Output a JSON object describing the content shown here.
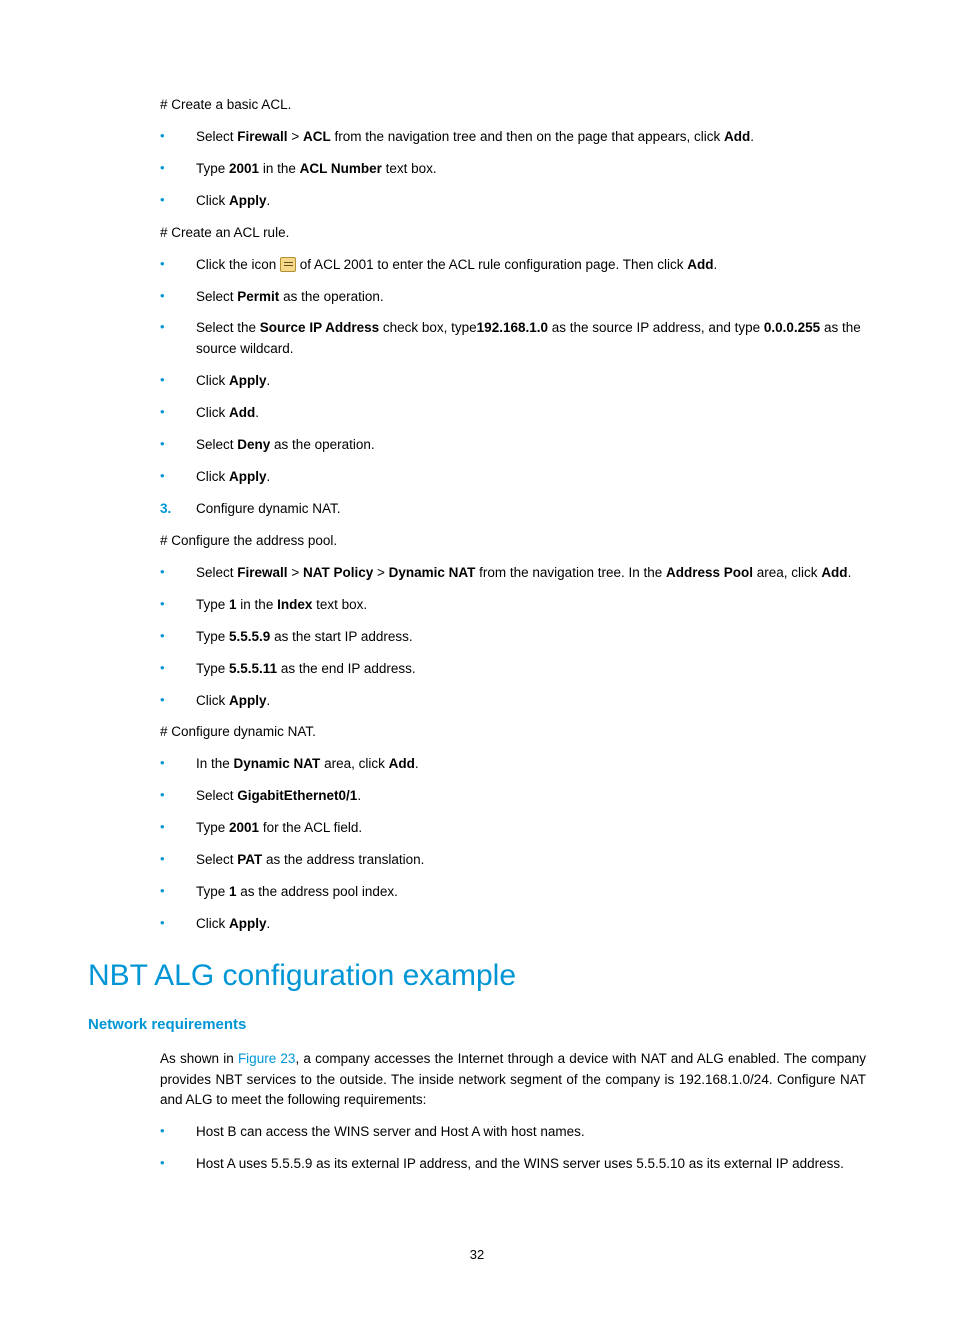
{
  "s1_para": "# Create a basic ACL.",
  "s1_b1_a": "Select ",
  "s1_b1_b": "Firewall",
  "s1_b1_c": " > ",
  "s1_b1_d": "ACL",
  "s1_b1_e": " from the navigation tree and then on the page that appears, click ",
  "s1_b1_f": "Add",
  "s1_b1_g": ".",
  "s1_b2_a": "Type ",
  "s1_b2_b": "2001",
  "s1_b2_c": " in the ",
  "s1_b2_d": "ACL Number",
  "s1_b2_e": " text box.",
  "s1_b3_a": "Click ",
  "s1_b3_b": "Apply",
  "s1_b3_c": ".",
  "s2_para": "# Create an ACL rule.",
  "s2_b1_a": "Click the icon ",
  "s2_b1_b": " of ACL 2001 to enter the ACL rule configuration page. Then click ",
  "s2_b1_c": "Add",
  "s2_b1_d": ".",
  "s2_b2_a": "Select ",
  "s2_b2_b": "Permit",
  "s2_b2_c": " as the operation.",
  "s2_b3_a": "Select the ",
  "s2_b3_b": "Source IP Address",
  "s2_b3_c": " check box, type",
  "s2_b3_d": "192.168.1.0",
  "s2_b3_e": " as the source IP address, and type ",
  "s2_b3_f": "0.0.0.255",
  "s2_b3_g": " as the source wildcard.",
  "s2_b4_a": "Click ",
  "s2_b4_b": "Apply",
  "s2_b4_c": ".",
  "s2_b5_a": "Click ",
  "s2_b5_b": "Add",
  "s2_b5_c": ".",
  "s2_b6_a": "Select ",
  "s2_b6_b": "Deny",
  "s2_b6_c": " as the operation.",
  "s2_b7_a": "Click ",
  "s2_b7_b": "Apply",
  "s2_b7_c": ".",
  "step3_num": "3.",
  "step3_text": "Configure dynamic NAT.",
  "s3_para": "# Configure the address pool.",
  "s3_b1_a": "Select ",
  "s3_b1_b": "Firewall",
  "s3_b1_c": " > ",
  "s3_b1_d": "NAT Policy",
  "s3_b1_e": " > ",
  "s3_b1_f": "Dynamic NAT",
  "s3_b1_g": " from the navigation tree. In the ",
  "s3_b1_h": "Address Pool",
  "s3_b1_i": " area, click ",
  "s3_b1_j": "Add",
  "s3_b1_k": ".",
  "s3_b2_a": "Type ",
  "s3_b2_b": "1",
  "s3_b2_c": " in the ",
  "s3_b2_d": "Index",
  "s3_b2_e": " text box.",
  "s3_b3_a": "Type ",
  "s3_b3_b": "5.5.5.9",
  "s3_b3_c": " as the start IP address.",
  "s3_b4_a": "Type ",
  "s3_b4_b": "5.5.5.11",
  "s3_b4_c": " as the end IP address.",
  "s3_b5_a": "Click ",
  "s3_b5_b": "Apply",
  "s3_b5_c": ".",
  "s4_para": "# Configure dynamic NAT.",
  "s4_b1_a": "In the ",
  "s4_b1_b": "Dynamic NAT",
  "s4_b1_c": " area, click ",
  "s4_b1_d": "Add",
  "s4_b1_e": ".",
  "s4_b2_a": "Select ",
  "s4_b2_b": "GigabitEthernet0/1",
  "s4_b2_c": ".",
  "s4_b3_a": "Type ",
  "s4_b3_b": "2001",
  "s4_b3_c": " for the ACL field.",
  "s4_b4_a": "Select ",
  "s4_b4_b": "PAT",
  "s4_b4_c": " as the address translation.",
  "s4_b5_a": "Type ",
  "s4_b5_b": "1",
  "s4_b5_c": " as the address pool index.",
  "s4_b6_a": "Click ",
  "s4_b6_b": "Apply",
  "s4_b6_c": ".",
  "h1": "NBT ALG configuration example",
  "h2": "Network requirements",
  "intro_a": "As shown in ",
  "intro_fig": "Figure 23",
  "intro_b": ", a company accesses the Internet through a device with NAT and ALG enabled. The company provides NBT services to the outside. The inside network segment of the company is 192.168.1.0/24. Configure NAT and ALG to meet the following requirements:",
  "req1": "Host B can access the WINS server and Host A with host names.",
  "req2": "Host A uses 5.5.5.9 as its external IP address, and the WINS server uses 5.5.5.10 as its external IP address.",
  "page_num": "32"
}
